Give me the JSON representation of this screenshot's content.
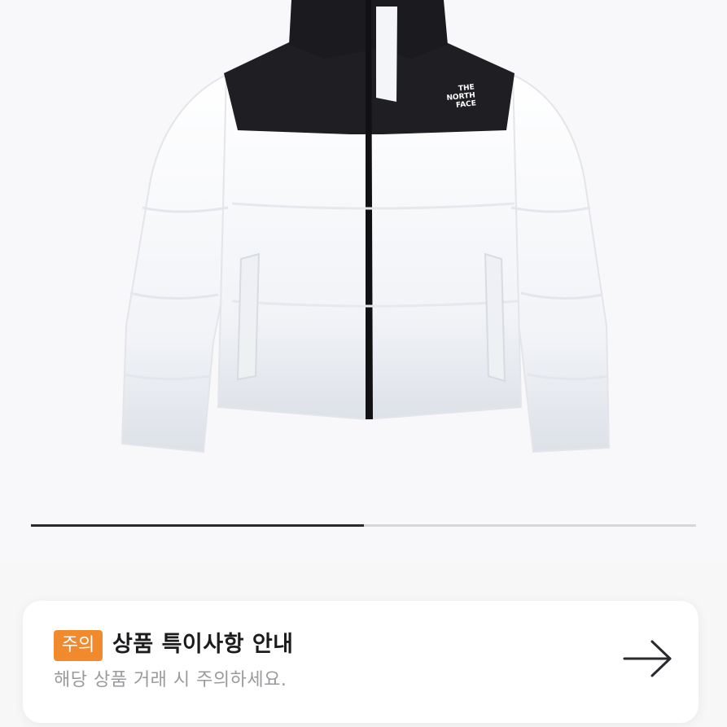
{
  "product": {
    "image_name": "white-black-puffer-jacket",
    "logo_text": [
      "THE",
      "NORTH",
      "FACE"
    ]
  },
  "carousel": {
    "progress_fraction": 0.5
  },
  "notice": {
    "badge": "주의",
    "title": "상품 특이사항 안내",
    "subtitle": "해당 상품 거래 시 주의하세요.",
    "arrow_icon": "arrow-right-icon"
  },
  "colors": {
    "badge_bg": "#f08a2c",
    "progress": "#2b2b2f",
    "track": "#d6d6d8"
  }
}
